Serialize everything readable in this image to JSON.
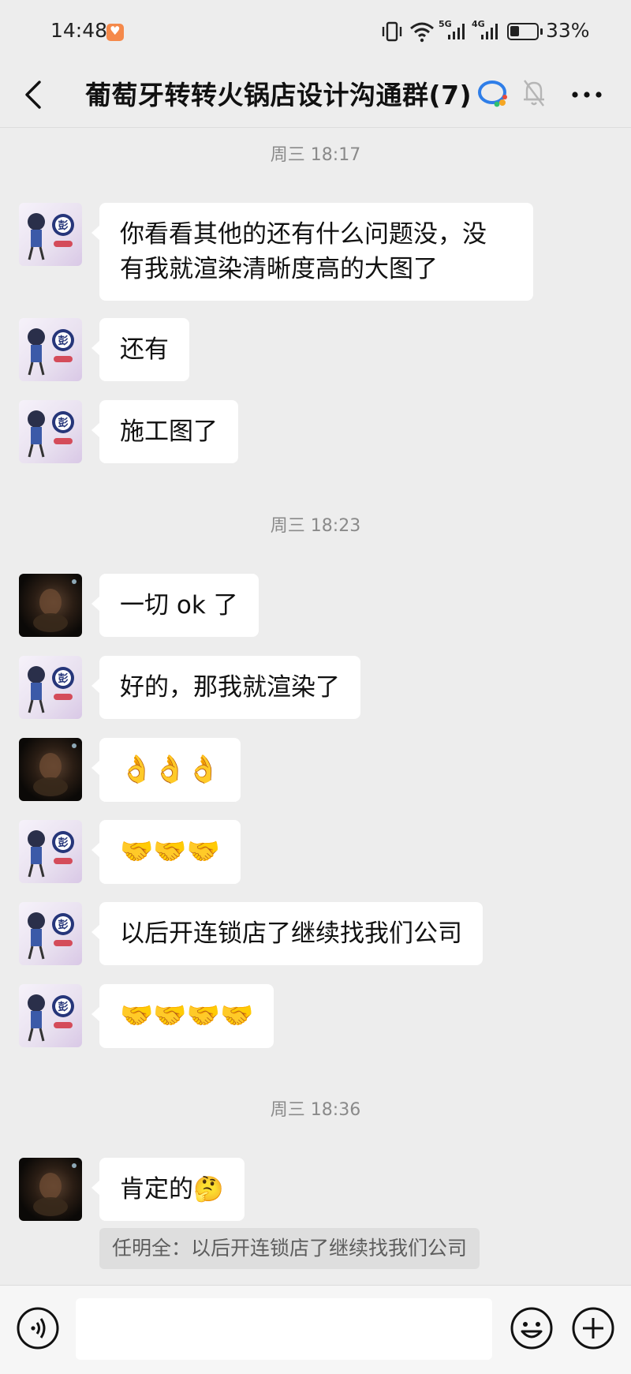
{
  "status_bar": {
    "time": "14:48",
    "network_labels": [
      "5G",
      "4G"
    ],
    "battery": "33%"
  },
  "header": {
    "title": "葡萄牙转转火锅店设计沟通群(7)"
  },
  "timestamps": [
    "周三 18:17",
    "周三 18:23",
    "周三 18:36"
  ],
  "messages": [
    {
      "sender": "a",
      "text": "你看看其他的还有什么问题没，没\n有我就渲染清晰度高的大图了"
    },
    {
      "sender": "a",
      "text": "还有"
    },
    {
      "sender": "a",
      "text": "施工图了"
    },
    {
      "sender": "b",
      "text": "一切 ok 了"
    },
    {
      "sender": "a",
      "text": "好的，那我就渲染了"
    },
    {
      "sender": "b",
      "text": "👌👌👌"
    },
    {
      "sender": "a",
      "text": "🤝🤝🤝"
    },
    {
      "sender": "a",
      "text": "以后开连锁店了继续找我们公司"
    },
    {
      "sender": "a",
      "text": "🤝🤝🤝🤝"
    },
    {
      "sender": "b",
      "text": "肯定的🤔"
    }
  ],
  "quote": "任明全：以后开连锁店了继续找我们公司",
  "avatar_a_badge": "彭",
  "input": {
    "placeholder": ""
  },
  "colors": {
    "background": "#ededed",
    "bubble": "#ffffff",
    "timestamp_text": "#8a8a8a",
    "quote_bg": "#dedede"
  }
}
